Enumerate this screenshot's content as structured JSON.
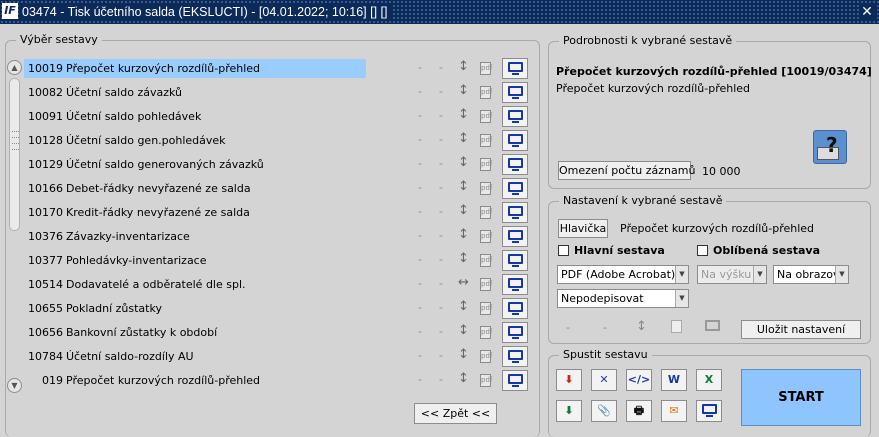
{
  "window": {
    "title": "03474 - Tisk účetního salda (EKSLUCTI) - [04.01.2022; 10:16] [] []",
    "logo": "IF",
    "close": "✕"
  },
  "list_group": {
    "label": "Výběr sestavy"
  },
  "reports": [
    {
      "num": "10019",
      "name": "Přepočet kurzových rozdílů-přehled",
      "selected": true,
      "arrow": "↕"
    },
    {
      "num": "10082",
      "name": "Účetní saldo závazků",
      "arrow": "↕"
    },
    {
      "num": "10091",
      "name": "Účetní saldo pohledávek",
      "arrow": "↕"
    },
    {
      "num": "10128",
      "name": "Účetní saldo gen.pohledávek",
      "arrow": "↕"
    },
    {
      "num": "10129",
      "name": "Účetní saldo generovaných závazků",
      "arrow": "↕"
    },
    {
      "num": "10166",
      "name": "Debet-řádky nevyřazené ze salda",
      "arrow": "↕"
    },
    {
      "num": "10170",
      "name": "Kredit-řádky nevyřazené ze salda",
      "arrow": "↕"
    },
    {
      "num": "10376",
      "name": "Závazky-inventarizace",
      "arrow": "↕"
    },
    {
      "num": "10377",
      "name": "Pohledávky-inventarizace",
      "arrow": "↕"
    },
    {
      "num": "10514",
      "name": "Dodavatelé a odběratelé dle spl.",
      "arrow": "↔"
    },
    {
      "num": "10655",
      "name": "Pokladní zůstatky",
      "arrow": "↕"
    },
    {
      "num": "10656",
      "name": "Bankovní zůstatky k období",
      "arrow": "↕"
    },
    {
      "num": "10784",
      "name": "Účetní saldo-rozdíly AU",
      "arrow": "↕"
    },
    {
      "num": "019",
      "name": "Přepočet kurzových rozdílů-přehled",
      "arrow": "↕"
    }
  ],
  "row_dash": "-",
  "pdf_glyph": "pdf",
  "back_button": "<< Zpět <<",
  "detail_group": {
    "label": "Podrobnosti k vybrané sestavě",
    "title": "Přepočet kurzových rozdílů-přehled [10019/03474]",
    "subtitle": "Přepočet kurzových rozdílů-přehled",
    "limit_button": "Omezení počtu záznamů",
    "limit_value": "10 000",
    "help_glyph": "?"
  },
  "settings_group": {
    "label": "Nastavení k vybrané sestavě",
    "header_button": "Hlavička",
    "header_text": "Přepočet kurzových rozdílů-přehled",
    "main_checkbox": "Hlavní sestava",
    "fav_checkbox": "Oblíbená sestava",
    "format_select": "PDF (Adobe Acrobat)",
    "orientation_select": "Na výšku",
    "output_select": "Na obrazovku",
    "sign_select": "Nepodepisovat",
    "dash": "-",
    "vert_arrow": "↕",
    "save_button": "Uložit nastavení"
  },
  "run_group": {
    "label": "Spustit sestavu",
    "tools_row1": [
      {
        "name": "pdf-export-icon",
        "glyph": "⬇",
        "color": "#d62020"
      },
      {
        "name": "tools-icon",
        "glyph": "✕",
        "color": "#2a3d8f"
      },
      {
        "name": "html-code-icon",
        "glyph": "</>",
        "color": "#1535a8"
      },
      {
        "name": "word-icon",
        "glyph": "W",
        "color": "#1535a8"
      },
      {
        "name": "excel-icon",
        "glyph": "X",
        "color": "#0e7a2e"
      }
    ],
    "tools_row2": [
      {
        "name": "download-icon",
        "glyph": "⬇",
        "color": "#0e7a2e"
      },
      {
        "name": "attachment-icon",
        "glyph": "📎",
        "color": "#555555"
      },
      {
        "name": "printer-icon",
        "glyph": "🖶",
        "color": "#111111"
      },
      {
        "name": "email-icon",
        "glyph": "✉",
        "color": "#e07a10"
      },
      {
        "name": "screen-icon",
        "glyph": "",
        "color": "#1535a8"
      }
    ],
    "start_button": "START"
  }
}
